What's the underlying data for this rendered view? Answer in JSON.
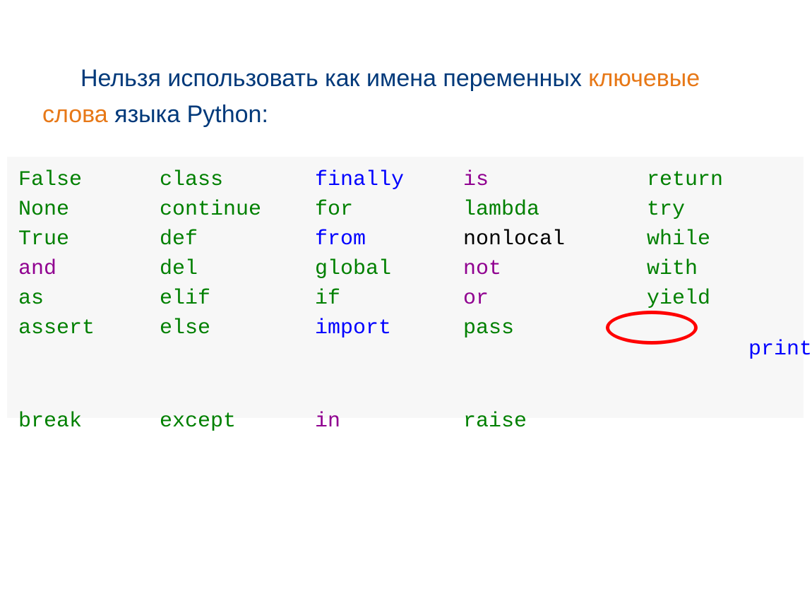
{
  "heading": {
    "part1": "Нельзя использовать как имена переменных ",
    "keywords_phrase": "ключевые слова",
    "part2": " языка Python:"
  },
  "keywords": {
    "col1": [
      "False",
      "None",
      "True",
      "and",
      "as",
      "assert",
      "break"
    ],
    "col2": [
      "class",
      "continue",
      "def",
      "del",
      "elif",
      "else",
      "except"
    ],
    "col3": [
      "finally",
      "for",
      "from",
      "global",
      "if",
      "import",
      "in"
    ],
    "col4": [
      "is",
      "lambda",
      "nonlocal",
      "not",
      "or",
      "pass",
      "raise"
    ],
    "col5": [
      "return",
      "try",
      "while",
      "with",
      "yield",
      "print"
    ]
  },
  "circled_keyword": "print"
}
